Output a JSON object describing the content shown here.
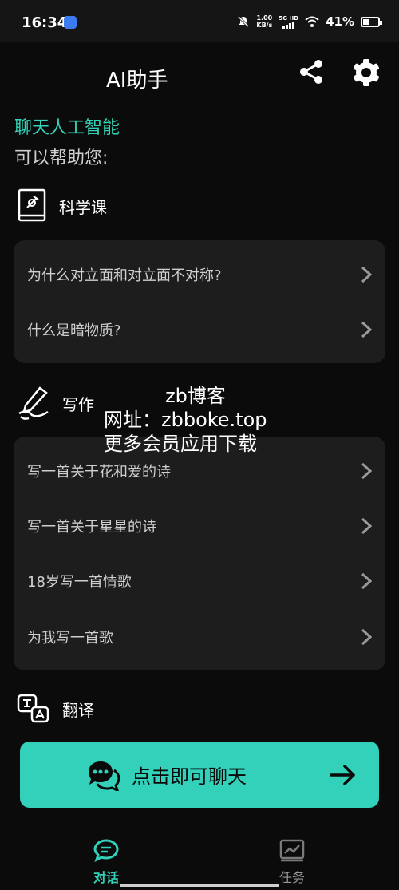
{
  "status_bar": {
    "time": "16:34",
    "net_speed_value": "1.00",
    "net_speed_unit": "KB/s",
    "signal_label": "5G HD",
    "battery": "41%"
  },
  "header": {
    "title": "AI助手"
  },
  "intro": {
    "title": "聊天人工智能",
    "subtitle": "可以帮助您:"
  },
  "sections": {
    "science": {
      "label": "科学课",
      "items": [
        "为什么对立面和对立面不对称?",
        "什么是暗物质?"
      ]
    },
    "writing": {
      "label": "写作",
      "items": [
        "写一首关于花和爱的诗",
        "写一首关于星星的诗",
        "18岁写一首情歌",
        "为我写一首歌"
      ]
    },
    "translate": {
      "label": "翻译"
    }
  },
  "watermark": {
    "line1": "zb博客",
    "line2": "网址：zbboke.top",
    "line3": "更多会员应用下载"
  },
  "chat_button": {
    "label": "点击即可聊天"
  },
  "tabs": [
    {
      "label": "对话"
    },
    {
      "label": "任务"
    }
  ],
  "colors": {
    "accent": "#33d1b9",
    "background": "#0b0b0b",
    "card": "#1d1d1d"
  }
}
